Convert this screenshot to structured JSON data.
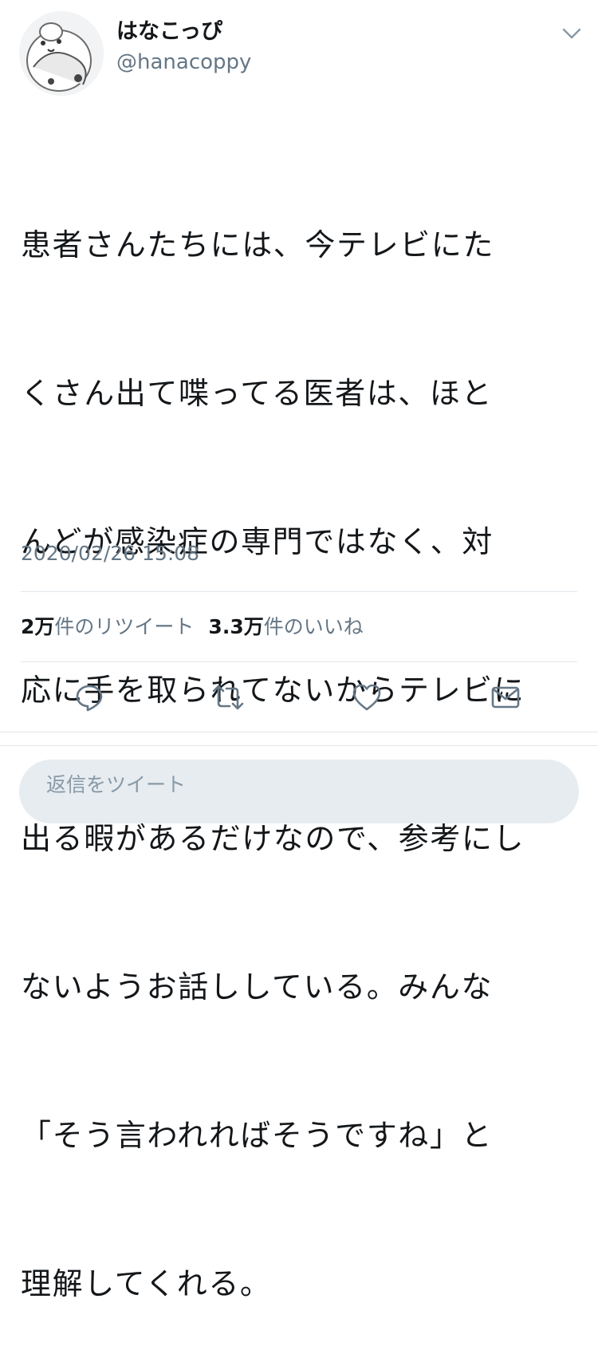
{
  "tweet": {
    "author": {
      "display_name": "はなこっぴ",
      "handle": "@hanacoppy"
    },
    "text_lines": [
      "患者さんたちには、今テレビにた",
      "くさん出て喋ってる医者は、ほと",
      "んどが感染症の専門ではなく、対",
      "応に手を取られてないからテレビに",
      "出る暇があるだけなので、参考にし",
      "ないようお話ししている。みんな",
      "「そう言われればそうですね」と",
      "理解してくれる。"
    ],
    "timestamp": "2020/02/26 15:08",
    "stats": {
      "retweets_count": "2万",
      "retweets_label": "件のリツイート",
      "likes_count": "3.3万",
      "likes_label": "件のいいね"
    }
  },
  "actions": {
    "icons": [
      "reply-icon",
      "retweet-icon",
      "like-icon",
      "share-icon"
    ]
  },
  "reply": {
    "placeholder": "返信をツイート"
  },
  "colors": {
    "text": "#14171a",
    "muted": "#657786",
    "divider": "#e1e8ed",
    "reply_bg": "#e6ecf0"
  }
}
